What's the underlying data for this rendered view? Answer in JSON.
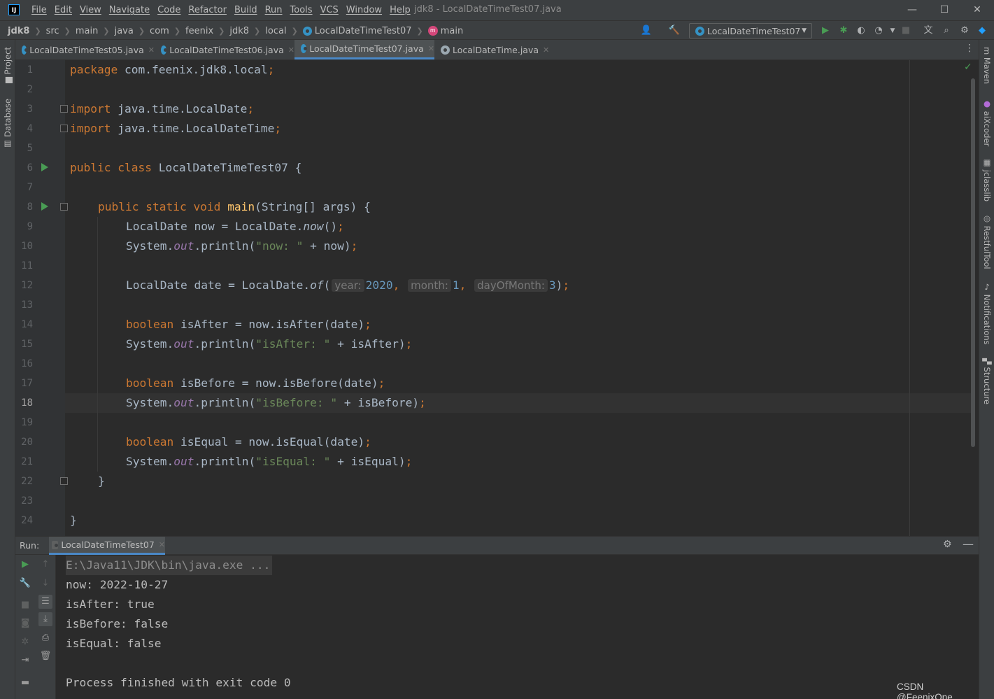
{
  "app": {
    "logo": "IJ",
    "window_title": "jdk8 - LocalDateTimeTest07.java"
  },
  "menu": [
    "File",
    "Edit",
    "View",
    "Navigate",
    "Code",
    "Refactor",
    "Build",
    "Run",
    "Tools",
    "VCS",
    "Window",
    "Help"
  ],
  "window_controls": {
    "minimize": "—",
    "maximize": "☐",
    "close": "✕"
  },
  "breadcrumbs": [
    "jdk8",
    "src",
    "main",
    "java",
    "com",
    "feenix",
    "jdk8",
    "local",
    "LocalDateTimeTest07",
    "main"
  ],
  "toolbar": {
    "run_config": "LocalDateTimeTest07"
  },
  "left_panel": {
    "project": "Project",
    "database": "Database"
  },
  "right_panel": {
    "maven": "Maven",
    "aixcoder": "aiXcoder",
    "jclasslib": "jclasslib",
    "restful": "RestfulTool",
    "notifications": "Notifications",
    "structure": "Structure"
  },
  "tabs": [
    {
      "label": "LocalDateTimeTest05.java"
    },
    {
      "label": "LocalDateTimeTest06.java"
    },
    {
      "label": "LocalDateTimeTest07.java"
    },
    {
      "label": "LocalDateTime.java"
    }
  ],
  "editor": {
    "line_numbers": [
      "1",
      "2",
      "3",
      "4",
      "5",
      "6",
      "7",
      "8",
      "9",
      "10",
      "11",
      "12",
      "13",
      "14",
      "15",
      "16",
      "17",
      "18",
      "19",
      "20",
      "21",
      "22",
      "23",
      "24"
    ],
    "current_line": "18",
    "code": {
      "l1_kw": "package",
      "l1_rest": " com.feenix.jdk8.local",
      "l3_kw": "import",
      "l3_rest": " java.time.LocalDate",
      "l4_kw": "import",
      "l4_rest": " java.time.LocalDateTime",
      "l6_kw": "public class",
      "l6_rest": " LocalDateTimeTest07 {",
      "l8_kw": "public static void",
      "l8_fn": "main",
      "l8_rest": "(String[] args) {",
      "l9_a": "LocalDate now = LocalDate.",
      "l9_m": "now",
      "l9_b": "()",
      "l10_a": "System.",
      "l10_f": "out",
      "l10_b": ".println(",
      "l10_s": "\"now: \"",
      "l10_c": " + now)",
      "l12_a": "LocalDate date = LocalDate.",
      "l12_m": "of",
      "l12_b": "(",
      "l12_h1": "year:",
      "l12_n1": "2020",
      "l12_h2": "month:",
      "l12_n2": "1",
      "l12_h3": "dayOfMonth:",
      "l12_n3": "3",
      "l12_c": ")",
      "l14_kw": "boolean",
      "l14_rest": " isAfter = now.isAfter(date)",
      "l15_a": "System.",
      "l15_f": "out",
      "l15_b": ".println(",
      "l15_s": "\"isAfter: \"",
      "l15_c": " + isAfter)",
      "l17_kw": "boolean",
      "l17_rest": " isBefore = now.isBefore(date)",
      "l18_a": "System.",
      "l18_f": "out",
      "l18_b": ".println(",
      "l18_s": "\"isBefore: \"",
      "l18_c": " + isBefore)",
      "l20_kw": "boolean",
      "l20_rest": " isEqual = now.isEqual(date)",
      "l21_a": "System.",
      "l21_f": "out",
      "l21_b": ".println(",
      "l21_s": "\"isEqual: \"",
      "l21_c": " + isEqual)",
      "l22": "}",
      "l24": "}",
      "semi": ";",
      "comma": ","
    }
  },
  "run_panel": {
    "label": "Run:",
    "tab": "LocalDateTimeTest07",
    "console": [
      "E:\\Java11\\JDK\\bin\\java.exe ...",
      "now: 2022-10-27",
      "isAfter: true",
      "isBefore: false",
      "isEqual: false",
      "",
      "Process finished with exit code 0"
    ]
  },
  "watermark": "CSDN @FeenixOne",
  "colors": {
    "keyword": "#cc7832",
    "string": "#6a8759",
    "number": "#6897bb",
    "method": "#ffc66d",
    "field": "#9876aa",
    "accent": "#4a88c7",
    "run": "#499c54"
  }
}
